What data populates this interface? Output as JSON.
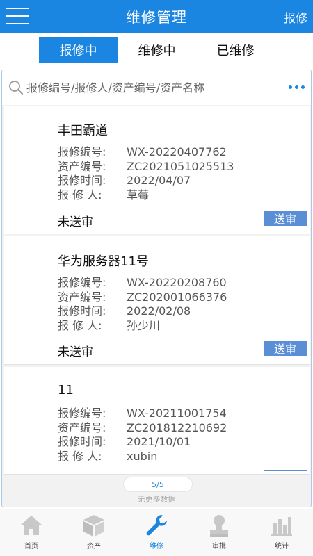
{
  "header": {
    "title": "维修管理",
    "action_label": "报修"
  },
  "tabs": [
    {
      "label": "报修中",
      "active": true
    },
    {
      "label": "维修中",
      "active": false
    },
    {
      "label": "已维修",
      "active": false
    }
  ],
  "search": {
    "placeholder": "报修编号/报修人/资产编号/资产名称"
  },
  "field_labels": {
    "repair_no": "报修编号:",
    "asset_no": "资产编号:",
    "repair_time": "报修时间:",
    "reporter": "报 修 人:"
  },
  "cards": [
    {
      "title": "丰田霸道",
      "repair_no": "WX-20220407762",
      "asset_no": "ZC2021051025513",
      "repair_time": "2022/04/07",
      "reporter": "草莓",
      "status": "未送审",
      "button_label": "送审"
    },
    {
      "title": "华为服务器11号",
      "repair_no": "WX-20220208760",
      "asset_no": "ZC202001066376",
      "repair_time": "2022/02/08",
      "reporter": "孙少川",
      "status": "未送审",
      "button_label": "送审"
    },
    {
      "title": "11",
      "repair_no": "WX-20211001754",
      "asset_no": "ZC201812210692",
      "repair_time": "2021/10/01",
      "reporter": "xubin"
    }
  ],
  "pager": {
    "text": "5/5",
    "no_more_text": "无更多数据"
  },
  "bottom_nav": [
    {
      "label": "首页",
      "icon": "home-icon",
      "active": false
    },
    {
      "label": "资产",
      "icon": "box-icon",
      "active": false
    },
    {
      "label": "维修",
      "icon": "wrench-icon",
      "active": true
    },
    {
      "label": "审批",
      "icon": "user-stamp-icon",
      "active": false
    },
    {
      "label": "统计",
      "icon": "bar-chart-icon",
      "active": false
    }
  ],
  "colors": {
    "primary": "#1a86e2",
    "button": "#5a8fd6",
    "nav_inactive": "#c8c8c8"
  }
}
